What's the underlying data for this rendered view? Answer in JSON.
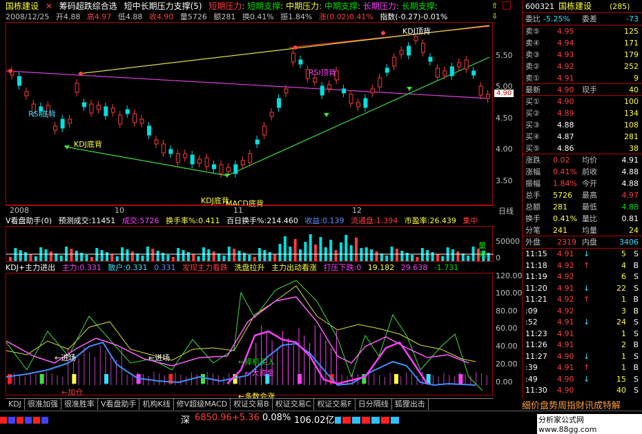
{
  "header": {
    "stock_name": "国栋建设",
    "indicator_name": "筹码超跌综合选",
    "indicator_desc": "短中长期压力支撑(5)",
    "short_pressure": "短期压力",
    "short_support": "短期支撑",
    "mid_pressure": "中期压力",
    "mid_support": "中期支撑",
    "long_pressure": "长期压力",
    "long_support": "长期支撑"
  },
  "infobar": {
    "date": "2008/12/25",
    "open": "开4.88",
    "high": "高4.97",
    "low": "低4.88",
    "close": "收4.90",
    "volume": "量5726",
    "amount": "额281",
    "turnover": "换0.41%",
    "amplitude": "振1.84%",
    "change": "涨(0.02)0.41%",
    "index": "指数(-0.27)-0.01%"
  },
  "price_axis": [
    "5.50",
    "5.00",
    "4.50",
    "4.00",
    "3.50"
  ],
  "last_price_tag": "4.90",
  "chart_labels": {
    "rsi_bottom": "RSI底背",
    "kdj_bottom_1": "KDJ底背",
    "kdj_bottom_2": "KDJ底背",
    "macd_bottom": "MACD底背",
    "rsi_top": "RSI顶背",
    "kdj_top": "KDJ顶背"
  },
  "date_axis": [
    "2008",
    "10",
    "11",
    "12"
  ],
  "date_axis_right": "日线",
  "volume_header": {
    "name": "V看盘助手(0)",
    "forecast": "预测成交:11451",
    "traded": "成交:5726",
    "turnover_rate": "换手率%:0.411",
    "hundred_day": "百日换手%:214.460",
    "profit": "收益:0.139",
    "flow": "流通盘:1.394",
    "pe": "市盈率:26.439",
    "concentration": "集中"
  },
  "volume_axis": [
    "50000",
    "0"
  ],
  "volume_side_label": "量减",
  "kdj_header": {
    "name": "KDJ+主力进出",
    "main": "主力:0.331",
    "retail": "散户:0.331",
    "value": "0.331",
    "signal1": "发现主力看跌",
    "signal2": "洗盘拉升",
    "signal3": "主力出动看涨",
    "signal4": "打压下跌:0",
    "val1": "19.182",
    "val2": "29.638",
    "val3": "-1.731"
  },
  "kdj_axis": [
    "120.00",
    "100.00",
    "80.00",
    "60.00",
    "40.00",
    "20.00",
    "0.00"
  ],
  "kdj_labels": {
    "enter1": "←进场",
    "enter2": "←进场",
    "add": "←加仓",
    "buy": "←择机买入",
    "big": "←大资金",
    "more": "←多数会涨"
  },
  "tabs": [
    "KDJ",
    "很准加强",
    "很准胜率",
    "V看盘助手",
    "机构K线",
    "修V超级MACD",
    "权证交易B",
    "权证交易C",
    "权证交易F",
    "日分隔线",
    "狐狸出击"
  ],
  "quote": {
    "code": "600321",
    "name": "国栋建设",
    "count": "(285)",
    "wb_label": "委比",
    "wb_value": "-5.25%",
    "wc_label": "委差",
    "wc_value": "-73",
    "asks": [
      {
        "label": "卖⑤",
        "price": "4.95",
        "vol": "125"
      },
      {
        "label": "卖④",
        "price": "4.94",
        "vol": "171"
      },
      {
        "label": "卖③",
        "price": "4.93",
        "vol": "179"
      },
      {
        "label": "卖②",
        "price": "4.92",
        "vol": "252"
      },
      {
        "label": "卖①",
        "price": "4.91",
        "vol": "9"
      }
    ],
    "latest_label": "最新",
    "latest": "4.90",
    "hand_label": "现手",
    "hand": "40",
    "bids": [
      {
        "label": "买①",
        "price": "4.90",
        "vol": "100"
      },
      {
        "label": "买②",
        "price": "4.89",
        "vol": "134"
      },
      {
        "label": "买③",
        "price": "4.88",
        "vol": "108"
      },
      {
        "label": "买④",
        "price": "4.87",
        "vol": "281"
      },
      {
        "label": "买⑤",
        "price": "4.86",
        "vol": "38"
      }
    ],
    "stats": [
      {
        "l1": "涨跌",
        "v1": "0.02",
        "l2": "均价",
        "v2": "4.91"
      },
      {
        "l1": "涨幅",
        "v1": "0.41%",
        "l2": "前收",
        "v2": "4.88"
      },
      {
        "l1": "振幅",
        "v1": "1.84%",
        "l2": "今开",
        "v2": "4.88"
      },
      {
        "l1": "总手",
        "v1": "5726",
        "l2": "最高",
        "v2": "4.97"
      },
      {
        "l1": "总额",
        "v1": "281",
        "l2": "最低",
        "v2": "4.88"
      },
      {
        "l1": "换手",
        "v1": "0.41%",
        "l2": "量比",
        "v2": "0.81"
      },
      {
        "l1": "分笔",
        "v1": "241",
        "l2": "均量",
        "v2": "24"
      }
    ],
    "outer_label": "外盘",
    "outer": "2319",
    "inner_label": "内盘",
    "inner": "3406",
    "ticks": [
      {
        "t": "11:15",
        "p": "4.91",
        "d": "↓",
        "v": "5",
        "s": "S"
      },
      {
        "t": "11:18",
        "p": "4.92",
        "d": "↑",
        "v": "4",
        "s": "B"
      },
      {
        "t": "11:19",
        "p": "4.92",
        "d": "",
        "v": "6",
        "s": "S"
      },
      {
        "t": "11:20",
        "p": "4.91",
        "d": "↓",
        "v": "22",
        "s": "S"
      },
      {
        "t": "11:21",
        "p": "4.92",
        "d": "↑",
        "v": "1",
        "s": "B"
      },
      {
        "t": ":09",
        "p": "4.92",
        "d": "",
        "v": "3",
        "s": "B"
      },
      {
        "t": ":52",
        "p": "4.91",
        "d": "↓",
        "v": "24",
        "s": "S"
      },
      {
        "t": "11:23",
        "p": "4.91",
        "d": "",
        "v": "1",
        "s": "S"
      },
      {
        "t": "11:26",
        "p": "4.91",
        "d": "",
        "v": "2",
        "s": "B"
      },
      {
        "t": "11:27",
        "p": "4.90",
        "d": "↓",
        "v": "1",
        "s": "S"
      },
      {
        "t": ":39",
        "p": "4.91",
        "d": "↑",
        "v": "1",
        "s": "B"
      },
      {
        "t": ":49",
        "p": "4.90",
        "d": "↓",
        "v": "15",
        "s": "S"
      },
      {
        "t": "11:30",
        "p": "4.90",
        "d": "",
        "v": "40",
        "s": "S"
      }
    ],
    "detail_tabs": "细价盘势周指财讯成特解"
  },
  "bottom": {
    "market": "深",
    "index": "6850.96",
    "change": "+5.36",
    "pct": "0.08%",
    "amount": "106.02亿",
    "brand": "分析家公式网www.88gg.com"
  },
  "colors": {
    "up": "#ff3c3c",
    "down": "#00e0e0",
    "frame": "#b00000"
  }
}
